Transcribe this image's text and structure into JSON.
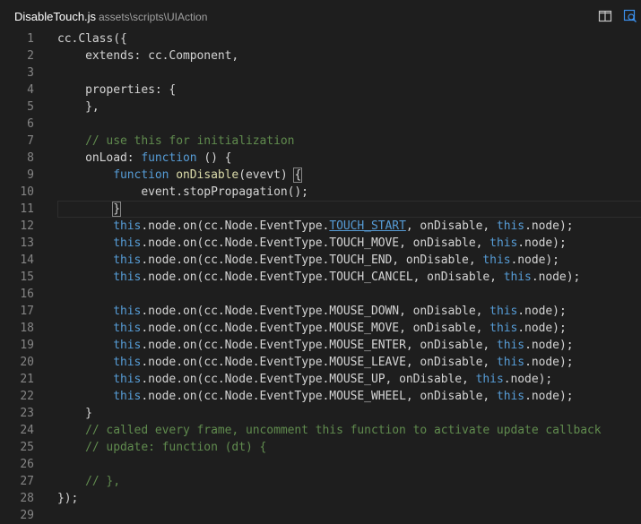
{
  "tab": {
    "file_name": "DisableTouch.js",
    "path": "assets\\scripts\\UIAction",
    "split_icon": "split-editor-icon",
    "preview_icon": "open-preview-icon"
  },
  "colors": {
    "background": "#1e1e1e",
    "text": "#d4d4d4",
    "keyword": "#569cd6",
    "function": "#dcdcaa",
    "comment": "#608b4e",
    "line_number": "#858585"
  },
  "editor": {
    "current_line": 11,
    "lines": [
      {
        "n": "1",
        "tokens": [
          {
            "t": "cc.Class({",
            "c": ""
          }
        ]
      },
      {
        "n": "2",
        "tokens": [
          {
            "t": "    extends: cc.Component,",
            "c": ""
          }
        ]
      },
      {
        "n": "3",
        "tokens": []
      },
      {
        "n": "4",
        "tokens": [
          {
            "t": "    properties: {",
            "c": ""
          }
        ]
      },
      {
        "n": "5",
        "tokens": [
          {
            "t": "    },",
            "c": ""
          }
        ]
      },
      {
        "n": "6",
        "tokens": []
      },
      {
        "n": "7",
        "tokens": [
          {
            "t": "    // use this for initialization",
            "c": "cm"
          }
        ]
      },
      {
        "n": "8",
        "tokens": [
          {
            "t": "    onLoad: ",
            "c": ""
          },
          {
            "t": "function",
            "c": "kw"
          },
          {
            "t": " () {",
            "c": ""
          }
        ]
      },
      {
        "n": "9",
        "tokens": [
          {
            "t": "        ",
            "c": ""
          },
          {
            "t": "function",
            "c": "kw"
          },
          {
            "t": " ",
            "c": ""
          },
          {
            "t": "onDisable",
            "c": "fn"
          },
          {
            "t": "(evevt) ",
            "c": ""
          },
          {
            "t": "{",
            "c": "br"
          }
        ]
      },
      {
        "n": "10",
        "tokens": [
          {
            "t": "            event.stopPropagation();",
            "c": ""
          }
        ]
      },
      {
        "n": "11",
        "tokens": [
          {
            "t": "        ",
            "c": ""
          },
          {
            "t": "}",
            "c": "br"
          }
        ]
      },
      {
        "n": "12",
        "tokens": [
          {
            "t": "        ",
            "c": ""
          },
          {
            "t": "this",
            "c": "kw"
          },
          {
            "t": ".node.on(cc.Node.EventType.",
            "c": ""
          },
          {
            "t": "TOUCH_START",
            "c": "hl"
          },
          {
            "t": ", onDisable, ",
            "c": ""
          },
          {
            "t": "this",
            "c": "kw"
          },
          {
            "t": ".node);",
            "c": ""
          }
        ]
      },
      {
        "n": "13",
        "tokens": [
          {
            "t": "        ",
            "c": ""
          },
          {
            "t": "this",
            "c": "kw"
          },
          {
            "t": ".node.on(cc.Node.EventType.TOUCH_MOVE, onDisable, ",
            "c": ""
          },
          {
            "t": "this",
            "c": "kw"
          },
          {
            "t": ".node);",
            "c": ""
          }
        ]
      },
      {
        "n": "14",
        "tokens": [
          {
            "t": "        ",
            "c": ""
          },
          {
            "t": "this",
            "c": "kw"
          },
          {
            "t": ".node.on(cc.Node.EventType.TOUCH_END, onDisable, ",
            "c": ""
          },
          {
            "t": "this",
            "c": "kw"
          },
          {
            "t": ".node);",
            "c": ""
          }
        ]
      },
      {
        "n": "15",
        "tokens": [
          {
            "t": "        ",
            "c": ""
          },
          {
            "t": "this",
            "c": "kw"
          },
          {
            "t": ".node.on(cc.Node.EventType.TOUCH_CANCEL, onDisable, ",
            "c": ""
          },
          {
            "t": "this",
            "c": "kw"
          },
          {
            "t": ".node);",
            "c": ""
          }
        ]
      },
      {
        "n": "16",
        "tokens": []
      },
      {
        "n": "17",
        "tokens": [
          {
            "t": "        ",
            "c": ""
          },
          {
            "t": "this",
            "c": "kw"
          },
          {
            "t": ".node.on(cc.Node.EventType.MOUSE_DOWN, onDisable, ",
            "c": ""
          },
          {
            "t": "this",
            "c": "kw"
          },
          {
            "t": ".node);",
            "c": ""
          }
        ]
      },
      {
        "n": "18",
        "tokens": [
          {
            "t": "        ",
            "c": ""
          },
          {
            "t": "this",
            "c": "kw"
          },
          {
            "t": ".node.on(cc.Node.EventType.MOUSE_MOVE, onDisable, ",
            "c": ""
          },
          {
            "t": "this",
            "c": "kw"
          },
          {
            "t": ".node);",
            "c": ""
          }
        ]
      },
      {
        "n": "19",
        "tokens": [
          {
            "t": "        ",
            "c": ""
          },
          {
            "t": "this",
            "c": "kw"
          },
          {
            "t": ".node.on(cc.Node.EventType.MOUSE_ENTER, onDisable, ",
            "c": ""
          },
          {
            "t": "this",
            "c": "kw"
          },
          {
            "t": ".node);",
            "c": ""
          }
        ]
      },
      {
        "n": "20",
        "tokens": [
          {
            "t": "        ",
            "c": ""
          },
          {
            "t": "this",
            "c": "kw"
          },
          {
            "t": ".node.on(cc.Node.EventType.MOUSE_LEAVE, onDisable, ",
            "c": ""
          },
          {
            "t": "this",
            "c": "kw"
          },
          {
            "t": ".node);",
            "c": ""
          }
        ]
      },
      {
        "n": "21",
        "tokens": [
          {
            "t": "        ",
            "c": ""
          },
          {
            "t": "this",
            "c": "kw"
          },
          {
            "t": ".node.on(cc.Node.EventType.MOUSE_UP, onDisable, ",
            "c": ""
          },
          {
            "t": "this",
            "c": "kw"
          },
          {
            "t": ".node);",
            "c": ""
          }
        ]
      },
      {
        "n": "22",
        "tokens": [
          {
            "t": "        ",
            "c": ""
          },
          {
            "t": "this",
            "c": "kw"
          },
          {
            "t": ".node.on(cc.Node.EventType.MOUSE_WHEEL, onDisable, ",
            "c": ""
          },
          {
            "t": "this",
            "c": "kw"
          },
          {
            "t": ".node);",
            "c": ""
          }
        ]
      },
      {
        "n": "23",
        "tokens": [
          {
            "t": "    }",
            "c": ""
          }
        ]
      },
      {
        "n": "24",
        "tokens": [
          {
            "t": "    // called every frame, uncomment this function to activate update callback",
            "c": "cm"
          }
        ]
      },
      {
        "n": "25",
        "tokens": [
          {
            "t": "    // update: function (dt) {",
            "c": "cm"
          }
        ]
      },
      {
        "n": "26",
        "tokens": []
      },
      {
        "n": "27",
        "tokens": [
          {
            "t": "    // },",
            "c": "cm"
          }
        ]
      },
      {
        "n": "28",
        "tokens": [
          {
            "t": "});",
            "c": ""
          }
        ]
      },
      {
        "n": "29",
        "tokens": []
      }
    ]
  }
}
